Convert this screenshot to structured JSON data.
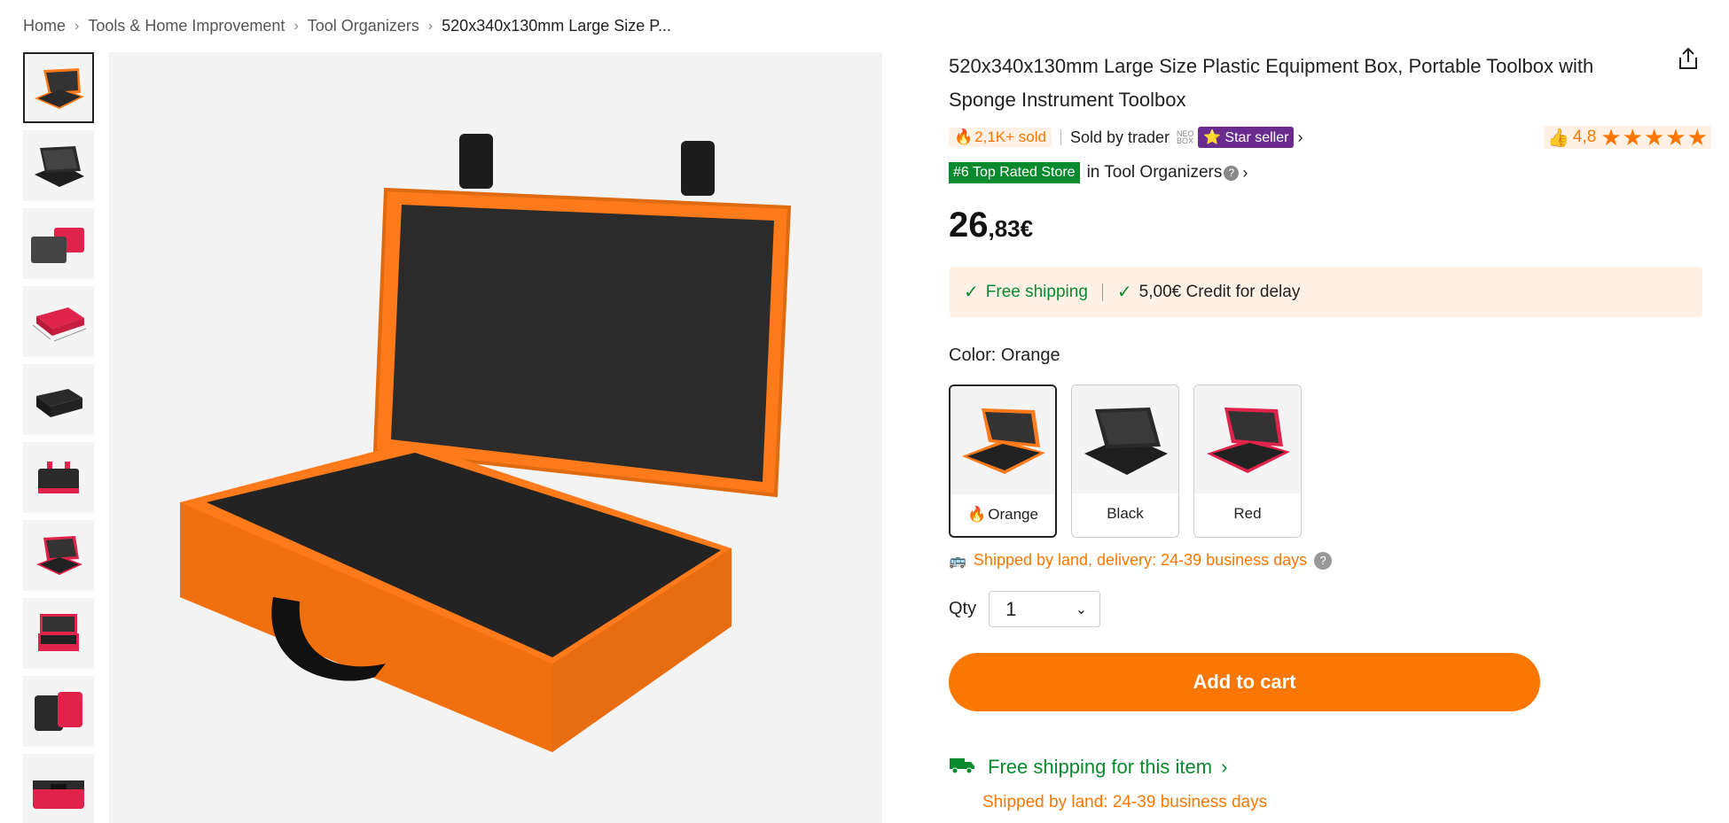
{
  "breadcrumb": {
    "items": [
      "Home",
      "Tools & Home Improvement",
      "Tool Organizers"
    ],
    "current": "520x340x130mm Large Size P..."
  },
  "product": {
    "title": "520x340x130mm Large Size Plastic Equipment Box, Portable Toolbox with Sponge Instrument Toolbox",
    "sold": "2,1K+ sold",
    "seller_text": "Sold by trader",
    "store_logo_text": "NEO BOX",
    "star_seller": "Star seller",
    "rating_value": "4,8",
    "rating_stars": 5,
    "rank_badge": "#6 Top Rated Store",
    "rank_category": "in Tool Organizers",
    "price_whole": "26",
    "price_decimal": ",83€"
  },
  "promo": {
    "free_shipping": "Free shipping",
    "credit": "5,00€ Credit for delay"
  },
  "color": {
    "label": "Color: Orange",
    "options": [
      {
        "name": "Orange",
        "selected": true,
        "color": "#ff7a1a"
      },
      {
        "name": "Black",
        "selected": false,
        "color": "#1e1e1e"
      },
      {
        "name": "Red",
        "selected": false,
        "color": "#e0234a"
      }
    ]
  },
  "shipping_note": "Shipped by land, delivery: 24-39 business days",
  "quantity": {
    "label": "Qty",
    "value": "1"
  },
  "cart": {
    "add_label": "Add to cart"
  },
  "free_shipping_item": {
    "label": "Free shipping for this item",
    "subtext": "Shipped by land: 24-39 business days"
  },
  "thumbnails": {
    "icons": [
      "case-orange",
      "case-black",
      "case-red-black",
      "case-red-dimensions",
      "case-black-closed",
      "case-red-black-closed",
      "case-red-open",
      "case-red-open-2",
      "case-black-red-side",
      "case-red-closed"
    ]
  },
  "colors": {
    "accent": "#fb7701",
    "green": "#0a8a2e",
    "star_seller_bg": "#6a2b8f"
  }
}
